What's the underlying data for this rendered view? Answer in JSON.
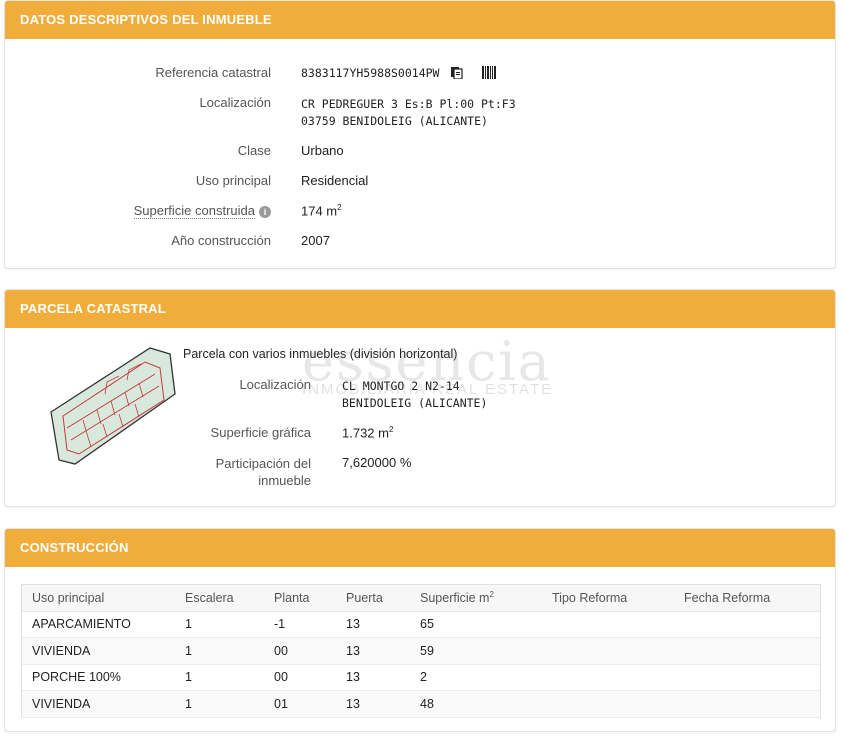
{
  "inmueble": {
    "header": "DATOS DESCRIPTIVOS DEL INMUEBLE",
    "ref_label": "Referencia catastral",
    "ref_value": "8383117YH5988S0014PW",
    "loc_label": "Localización",
    "loc_line1": "CR PEDREGUER 3 Es:B Pl:00 Pt:F3",
    "loc_line2": "03759 BENIDOLEIG (ALICANTE)",
    "clase_label": "Clase",
    "clase_value": "Urbano",
    "uso_label": "Uso principal",
    "uso_value": "Residencial",
    "sup_label": "Superficie construida",
    "sup_value": "174 m",
    "sup_unit_sup": "2",
    "ano_label": "Año construcción",
    "ano_value": "2007"
  },
  "parcela": {
    "header": "PARCELA CATASTRAL",
    "desc": "Parcela con varios inmuebles (división horizontal)",
    "loc_label": "Localización",
    "loc_line1": "CL MONTGO 2 N2-14",
    "loc_line2": "BENIDOLEIG (ALICANTE)",
    "sup_label": "Superficie gráfica",
    "sup_value": "1.732 m",
    "sup_unit_sup": "2",
    "part_label_1": "Participación del",
    "part_label_2": "inmueble",
    "part_value": "7,620000 %"
  },
  "watermark": {
    "brand": "essencia",
    "sub": "INMOBILIARIA  REAL ESTATE"
  },
  "construccion": {
    "header": "CONSTRUCCIÓN",
    "columns": [
      "Uso principal",
      "Escalera",
      "Planta",
      "Puerta",
      "Superficie m",
      "Tipo Reforma",
      "Fecha Reforma"
    ],
    "sup_col_sup": "2",
    "rows": [
      [
        "APARCAMIENTO",
        "1",
        "-1",
        "13",
        "65",
        "",
        ""
      ],
      [
        "VIVIENDA",
        "1",
        "00",
        "13",
        "59",
        "",
        ""
      ],
      [
        "PORCHE 100%",
        "1",
        "00",
        "13",
        "2",
        "",
        ""
      ],
      [
        "VIVIENDA",
        "1",
        "01",
        "13",
        "48",
        "",
        ""
      ]
    ]
  },
  "icons": {
    "copy": "copy-icon",
    "barcode": "barcode-icon",
    "info": "info-icon"
  },
  "colors": {
    "header_bg": "#f0ad3c",
    "parcel_fill": "#d9e8dc",
    "parcel_building": "#c23a3a"
  }
}
